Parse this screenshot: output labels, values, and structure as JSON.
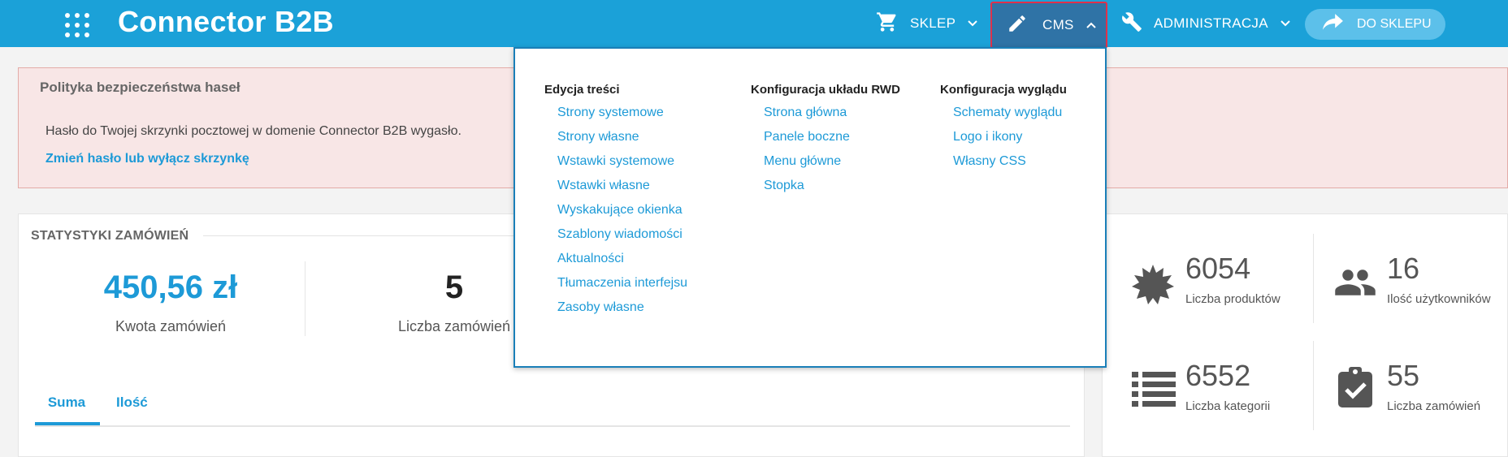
{
  "header": {
    "brand": "Connector B2B",
    "nav": [
      {
        "label": "SKLEP"
      },
      {
        "label": "CMS"
      },
      {
        "label": "ADMINISTRACJA"
      }
    ],
    "shop_button": "DO SKLEPU"
  },
  "colors": {
    "primary": "#1ba1d8",
    "active_nav": "#2f73a6",
    "highlight_border": "#e0304a",
    "link": "#1d9ad7",
    "alert_bg": "#f8e6e6"
  },
  "alert": {
    "title": "Polityka bezpieczeństwa haseł",
    "text": "Hasło do Twojej skrzynki pocztowej w domenie Connector B2B wygasło.",
    "link": "Zmień hasło lub wyłącz skrzynkę"
  },
  "stats": {
    "title": "STATYSTYKI ZAMÓWIEŃ",
    "amount_value": "450,56 zł",
    "amount_label": "Kwota zamówień",
    "count_value": "5",
    "count_label": "Liczba zamówień",
    "tabs": [
      {
        "label": "Suma"
      },
      {
        "label": "Ilość"
      }
    ]
  },
  "tiles": [
    {
      "value": "6054",
      "label": "Liczba produktów",
      "icon": "badge-star-icon"
    },
    {
      "value": "16",
      "label": "Ilość użytkowników",
      "icon": "users-icon"
    },
    {
      "value": "6552",
      "label": "Liczba kategorii",
      "icon": "list-icon"
    },
    {
      "value": "55",
      "label": "Liczba zamówień",
      "icon": "clipboard-check-icon"
    }
  ],
  "cms_menu": {
    "columns": [
      {
        "heading": "Edycja treści",
        "items": [
          "Strony systemowe",
          "Strony własne",
          "Wstawki systemowe",
          "Wstawki własne",
          "Wyskakujące okienka",
          "Szablony wiadomości",
          "Aktualności",
          "Tłumaczenia interfejsu",
          "Zasoby własne"
        ]
      },
      {
        "heading": "Konfiguracja układu RWD",
        "items": [
          "Strona główna",
          "Panele boczne",
          "Menu główne",
          "Stopka"
        ]
      },
      {
        "heading": "Konfiguracja wyglądu",
        "items": [
          "Schematy wyglądu",
          "Logo i ikony",
          "Własny CSS"
        ]
      }
    ]
  }
}
